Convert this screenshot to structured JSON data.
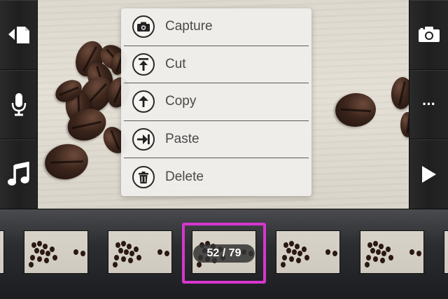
{
  "left_toolbar": {
    "buttons": [
      {
        "icon": "import-page-icon"
      },
      {
        "icon": "microphone-icon"
      },
      {
        "icon": "music-note-icon"
      }
    ]
  },
  "right_toolbar": {
    "buttons": [
      {
        "icon": "camera-icon"
      },
      {
        "icon": "more-icon",
        "label": "···"
      },
      {
        "icon": "play-icon"
      }
    ]
  },
  "context_menu": {
    "items": [
      {
        "label": "Capture",
        "icon": "camera-icon"
      },
      {
        "label": "Cut",
        "icon": "cut-icon"
      },
      {
        "label": "Copy",
        "icon": "copy-icon"
      },
      {
        "label": "Paste",
        "icon": "paste-icon"
      },
      {
        "label": "Delete",
        "icon": "trash-icon"
      }
    ]
  },
  "filmstrip": {
    "current_frame": 52,
    "total_frames": 79,
    "counter_label": "52 / 79",
    "highlight_color": "#d636d0"
  },
  "colors": {
    "toolbar_bg": "#232323",
    "menu_bg": "#eeede9",
    "menu_text": "#4a4a4a"
  }
}
